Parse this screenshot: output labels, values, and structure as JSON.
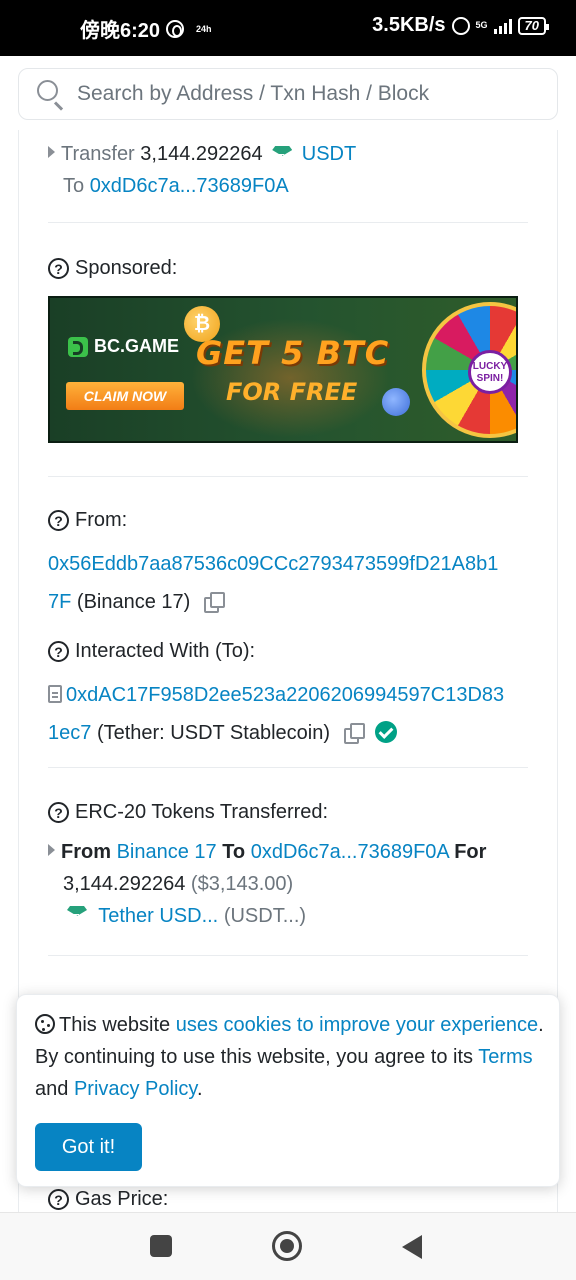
{
  "status_bar": {
    "time": "傍晚6:20",
    "small_label": "24h",
    "net_speed": "3.5KB/s",
    "network": "5G",
    "battery": "70"
  },
  "search": {
    "placeholder": "Search by Address / Txn Hash / Block"
  },
  "transfer": {
    "label": "Transfer",
    "amount": "3,144.292264",
    "token": "USDT",
    "to_label": "To",
    "to_address": "0xdD6c7a...73689F0A"
  },
  "sponsored": {
    "label": "Sponsored:",
    "banner": {
      "brand": "BC.GAME",
      "headline": "GET 5 BTC",
      "subline": "FOR FREE",
      "cta": "CLAIM NOW",
      "wheel_text": "LUCKY SPIN!"
    }
  },
  "from": {
    "label": "From:",
    "address_line1": "0x56Eddb7aa87536c09CCc2793473599fD21A8b1",
    "address_line2": "7F",
    "tag": "(Binance 17)"
  },
  "interacted": {
    "label": "Interacted With (To):",
    "address_line1": "0xdAC17F958D2ee523a2206206994597C13D83",
    "address_line2": "1ec7",
    "tag": "(Tether: USDT Stablecoin)"
  },
  "erc20": {
    "label": "ERC-20 Tokens Transferred:",
    "from_label": "From",
    "from_name": "Binance 17",
    "to_label": "To",
    "to_address": "0xdD6c7a...73689F0A",
    "for_label": "For",
    "amount": "3,144.292264",
    "usd": "($3,143.00)",
    "token_name": "Tether USD...",
    "token_symbol": "(USDT...)"
  },
  "cookie": {
    "text1": "This website ",
    "link1": "uses cookies to improve your experience",
    "text2": ". By continuing to use this website, you agree to its ",
    "link2": "Terms",
    "text3": " and ",
    "link3": "Privacy Policy",
    "text4": ".",
    "button": "Got it!"
  },
  "gas": {
    "label": "Gas Price:"
  },
  "colors": {
    "link": "#0784c3",
    "verified": "#00a186",
    "tether": "#26a17b"
  }
}
